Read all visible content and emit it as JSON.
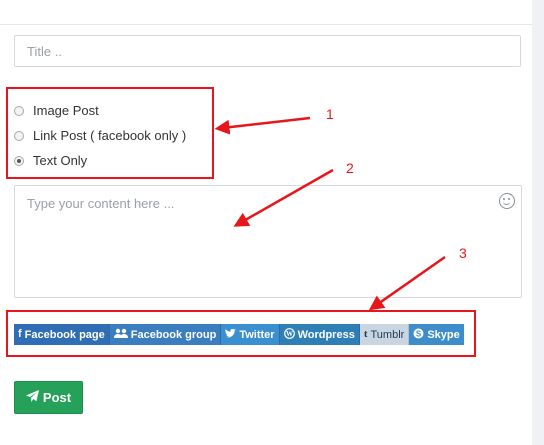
{
  "title_input": {
    "placeholder": "Title .."
  },
  "post_types": [
    {
      "label": "Image Post",
      "checked": false
    },
    {
      "label": "Link Post ( facebook only )",
      "checked": false
    },
    {
      "label": "Text Only",
      "checked": true
    }
  ],
  "content": {
    "placeholder": "Type your content here ...",
    "emoji_icon": "smiley-icon"
  },
  "share_targets": [
    {
      "label": "Facebook page",
      "icon": "facebook-icon"
    },
    {
      "label": "Facebook group",
      "icon": "users-icon"
    },
    {
      "label": "Twitter",
      "icon": "twitter-icon"
    },
    {
      "label": "Wordpress",
      "icon": "wordpress-icon"
    },
    {
      "label": "Tumblr",
      "icon": "tumblr-icon"
    },
    {
      "label": "Skype",
      "icon": "skype-icon"
    }
  ],
  "post_button": {
    "label": "Post",
    "icon": "send-icon"
  },
  "annotations": {
    "one": "1",
    "two": "2",
    "three": "3",
    "color": "#e8161a"
  }
}
